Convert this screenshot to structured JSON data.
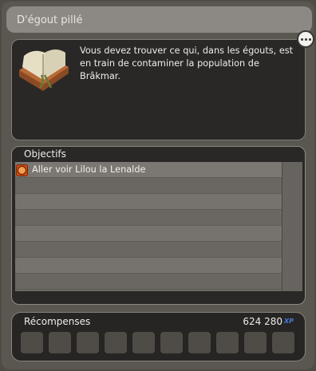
{
  "window": {
    "title": "D'égout pillé"
  },
  "quest": {
    "description": "Vous devez trouver ce qui, dans les égouts, est en train de contaminer la population de Brâkmar.",
    "icon": "quest-book-icon"
  },
  "objectives": {
    "header": "Objectifs",
    "items": [
      {
        "label": "Aller voir Lilou la Lenalde",
        "icon": "objective-target-icon"
      }
    ]
  },
  "rewards": {
    "header": "Récompenses",
    "xp_value": "624 280",
    "xp_unit": "XP",
    "slot_count": 10
  },
  "colors": {
    "accent_orange": "#d44d10",
    "xp_blue": "#4a78d8"
  }
}
